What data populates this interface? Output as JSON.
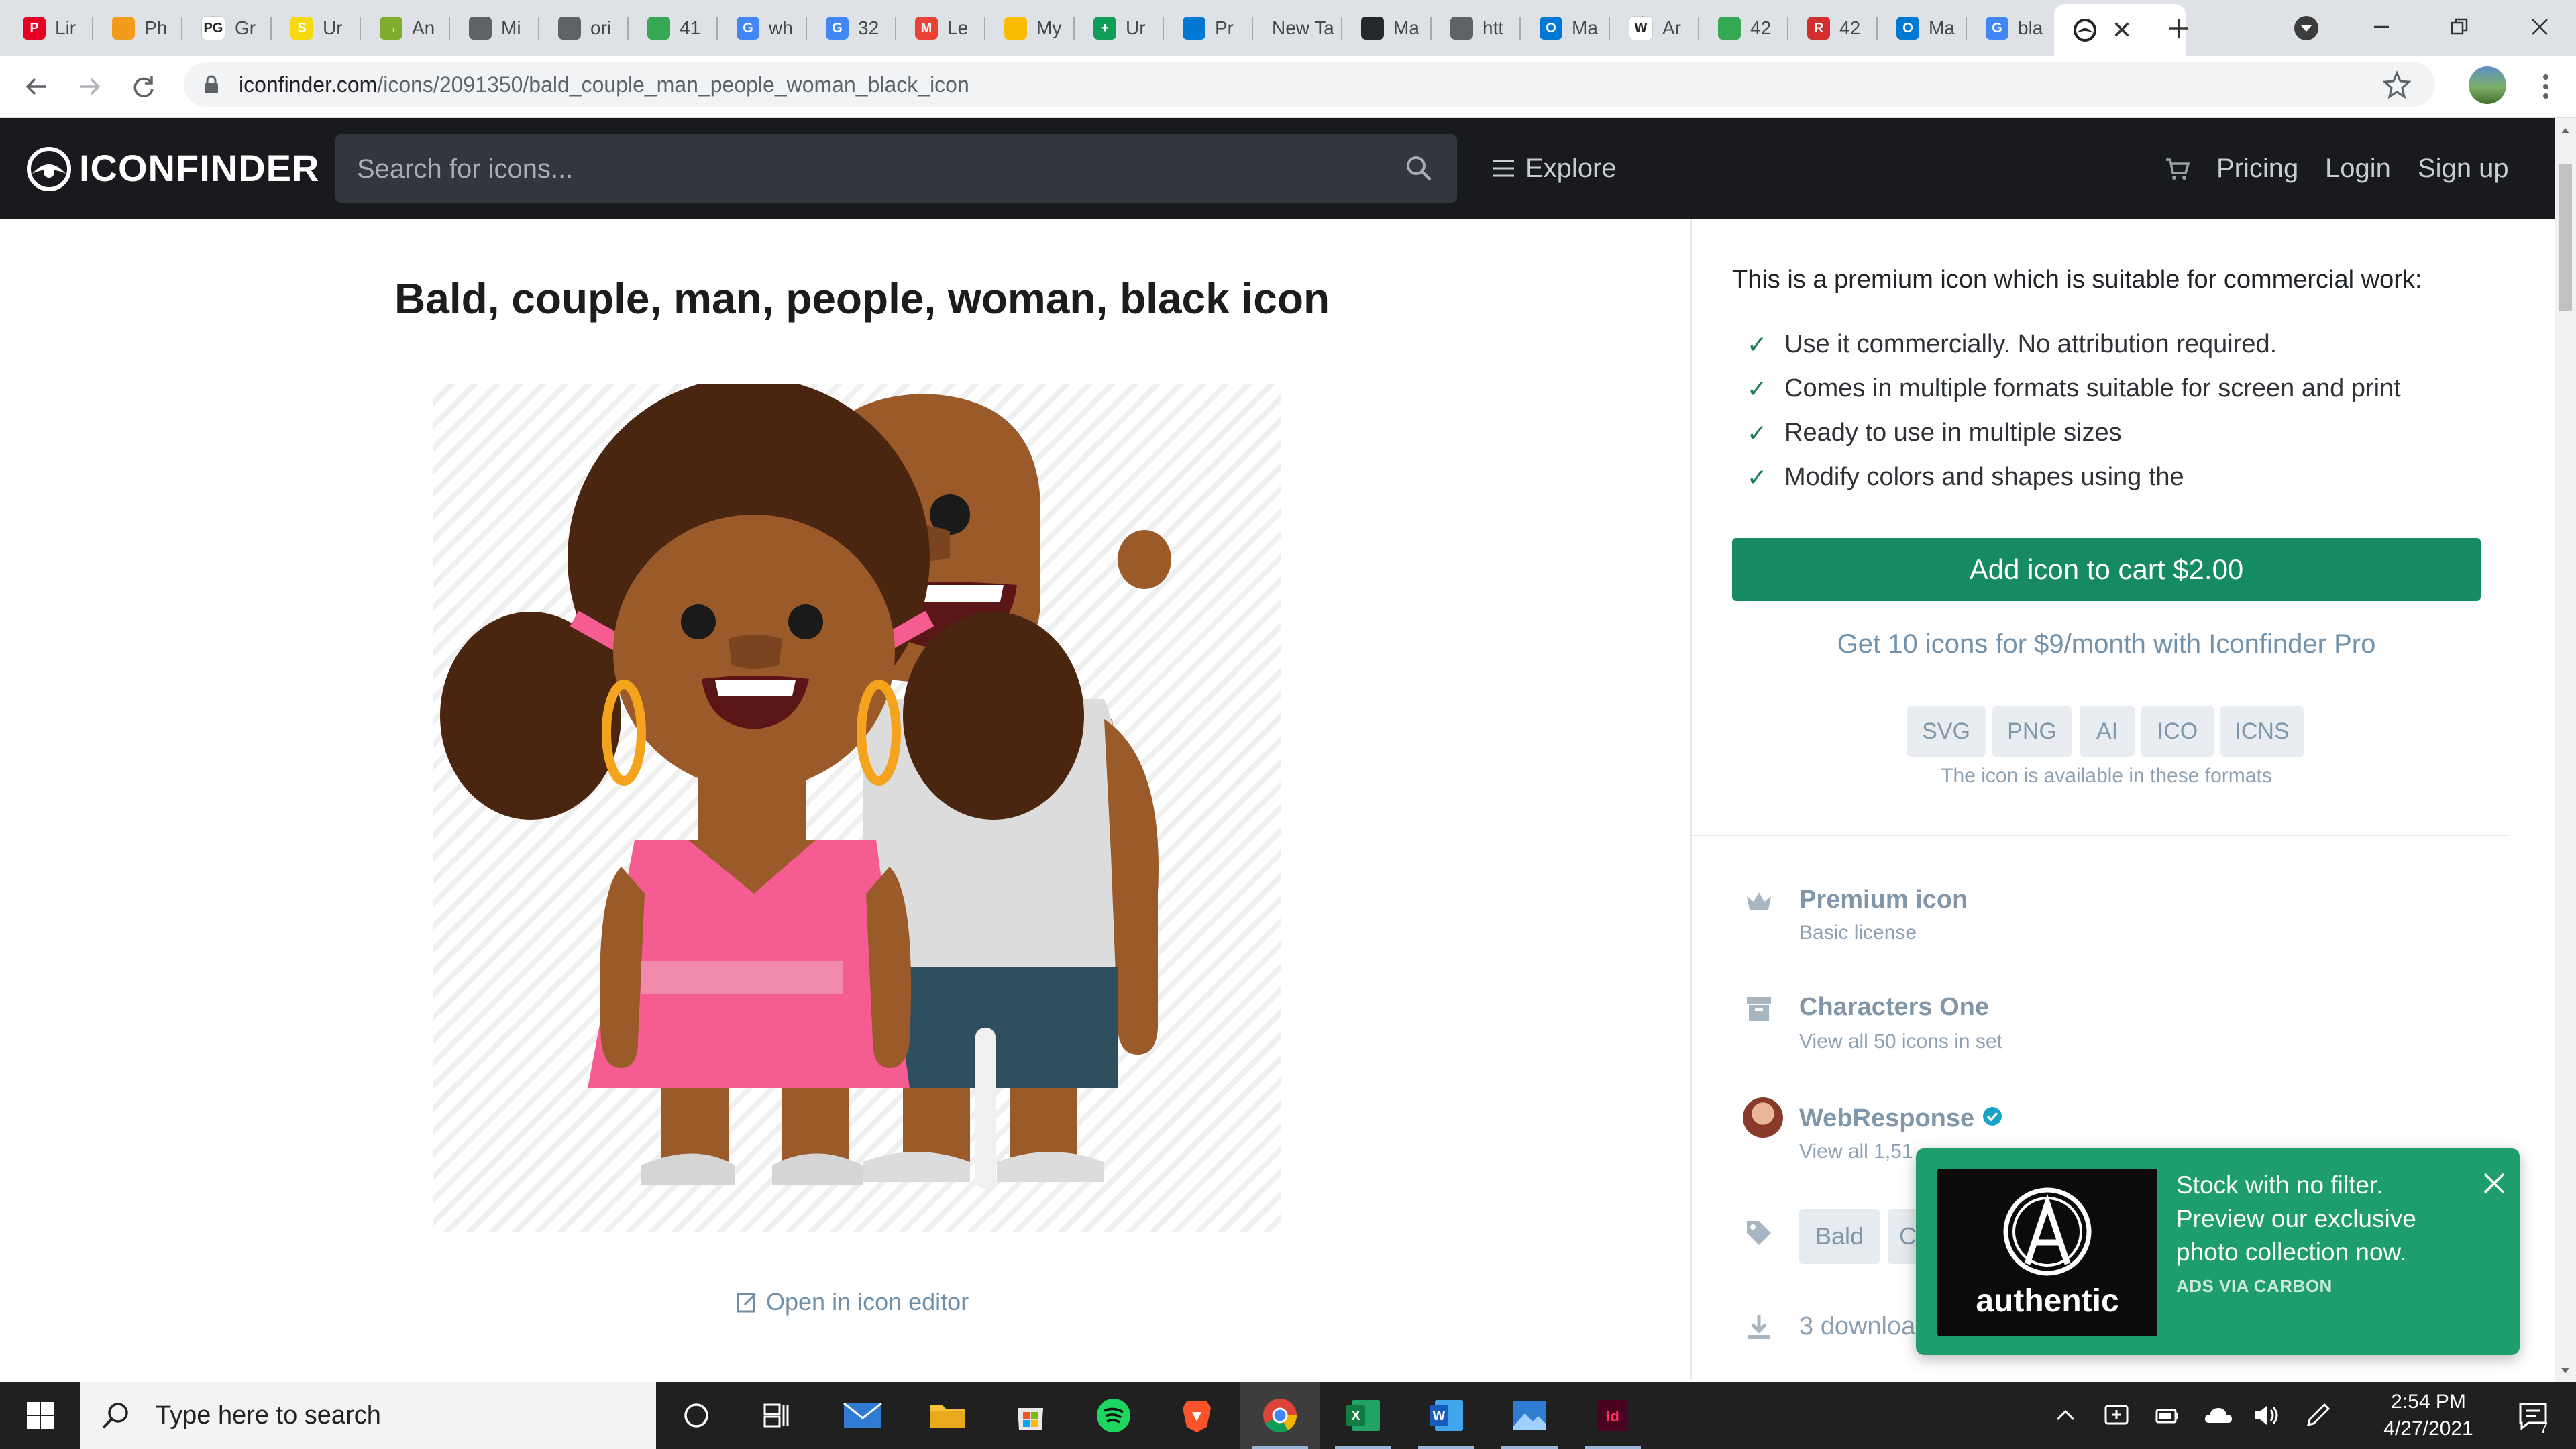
{
  "browser": {
    "tabs": [
      {
        "label": "Lir",
        "icon": "pinterest-icon",
        "color": "#e60023",
        "glyph": "P"
      },
      {
        "label": "Ph",
        "icon": "photo-app-icon",
        "color": "#f29b1d",
        "glyph": ""
      },
      {
        "label": "Gr",
        "icon": "phila-geo-icon",
        "color": "#ffffff",
        "glyph": "PG"
      },
      {
        "label": "Ur",
        "icon": "step-icon",
        "color": "#f4d90f",
        "glyph": "S"
      },
      {
        "label": "An",
        "icon": "arrow-app-icon",
        "color": "#7fae2c",
        "glyph": "→"
      },
      {
        "label": "Mi",
        "icon": "globe-icon",
        "color": "#5f6368",
        "glyph": ""
      },
      {
        "label": "ori",
        "icon": "globe-icon",
        "color": "#5f6368",
        "glyph": ""
      },
      {
        "label": "41",
        "icon": "maps-pin-icon",
        "color": "#34a853",
        "glyph": ""
      },
      {
        "label": "wh",
        "icon": "google-g-icon",
        "color": "#4285f4",
        "glyph": "G"
      },
      {
        "label": "32",
        "icon": "google-g-icon",
        "color": "#4285f4",
        "glyph": "G"
      },
      {
        "label": "Le",
        "icon": "gmail-icon",
        "color": "#ea4335",
        "glyph": "M"
      },
      {
        "label": "My",
        "icon": "google-drive-icon",
        "color": "#fbbc04",
        "glyph": ""
      },
      {
        "label": "Ur",
        "icon": "google-sheets-plus-icon",
        "color": "#0f9d58",
        "glyph": "+"
      },
      {
        "label": "Pr",
        "icon": "azure-icon",
        "color": "#0078d4",
        "glyph": ""
      },
      {
        "label": "New Ta",
        "icon": "",
        "color": "",
        "glyph": ""
      },
      {
        "label": "Ma",
        "icon": "github-icon",
        "color": "#24292e",
        "glyph": ""
      },
      {
        "label": "htt",
        "icon": "globe-icon",
        "color": "#5f6368",
        "glyph": ""
      },
      {
        "label": "Ma",
        "icon": "outlook-icon",
        "color": "#0078d4",
        "glyph": "O"
      },
      {
        "label": "Ar",
        "icon": "wikipedia-icon",
        "color": "#ffffff",
        "glyph": "W"
      },
      {
        "label": "42",
        "icon": "maps-pin-icon",
        "color": "#34a853",
        "glyph": ""
      },
      {
        "label": "42",
        "icon": "r-app-icon",
        "color": "#d32f2f",
        "glyph": "R"
      },
      {
        "label": "Ma",
        "icon": "outlook-icon",
        "color": "#0078d4",
        "glyph": "O"
      },
      {
        "label": "bla",
        "icon": "google-g-icon",
        "color": "#4285f4",
        "glyph": "G"
      }
    ],
    "active_tab_icon": "iconfinder-icon",
    "url_host": "iconfinder.com",
    "url_path": "/icons/2091350/bald_couple_man_people_woman_black_icon"
  },
  "site": {
    "logo": "ICONFINDER",
    "search_placeholder": "Search for icons...",
    "explore": "Explore",
    "pricing": "Pricing",
    "login": "Login",
    "signup": "Sign up"
  },
  "icon_page": {
    "title": "Bald, couple, man, people, woman, black icon",
    "open_editor": "Open in icon editor"
  },
  "sidebar": {
    "intro": "This is a premium icon which is suitable for commercial work:",
    "benefits": [
      "Use it commercially. No attribution required.",
      "Comes in multiple formats suitable for screen and print",
      "Ready to use in multiple sizes",
      "Modify colors and shapes using the"
    ],
    "cart_button": "Add icon to cart $2.00",
    "pro_offer": "Get 10 icons for $9/month with Iconfinder Pro",
    "formats": [
      "SVG",
      "PNG",
      "AI",
      "ICO",
      "ICNS"
    ],
    "formats_caption": "The icon is available in these formats",
    "license_title": "Premium icon",
    "license_sub": "Basic license",
    "set_title": "Characters One",
    "set_sub": "View all 50 icons in set",
    "author_title": "WebResponse",
    "author_sub": "View all 1,51",
    "tags": [
      "Bald",
      "C"
    ],
    "downloads": "3 downloa"
  },
  "ad": {
    "brand": "authentic",
    "text": "Stock with no filter. Preview our exclusive photo collection now.",
    "via": "ADS VIA CARBON"
  },
  "taskbar": {
    "search_placeholder": "Type here to search",
    "time": "2:54 PM",
    "date": "4/27/2021",
    "notification_count": "7"
  },
  "colors": {
    "site_header": "#191a1d",
    "cart_green": "#168b63",
    "ad_green": "#1e9e6c",
    "link_blue": "#7192ac"
  }
}
